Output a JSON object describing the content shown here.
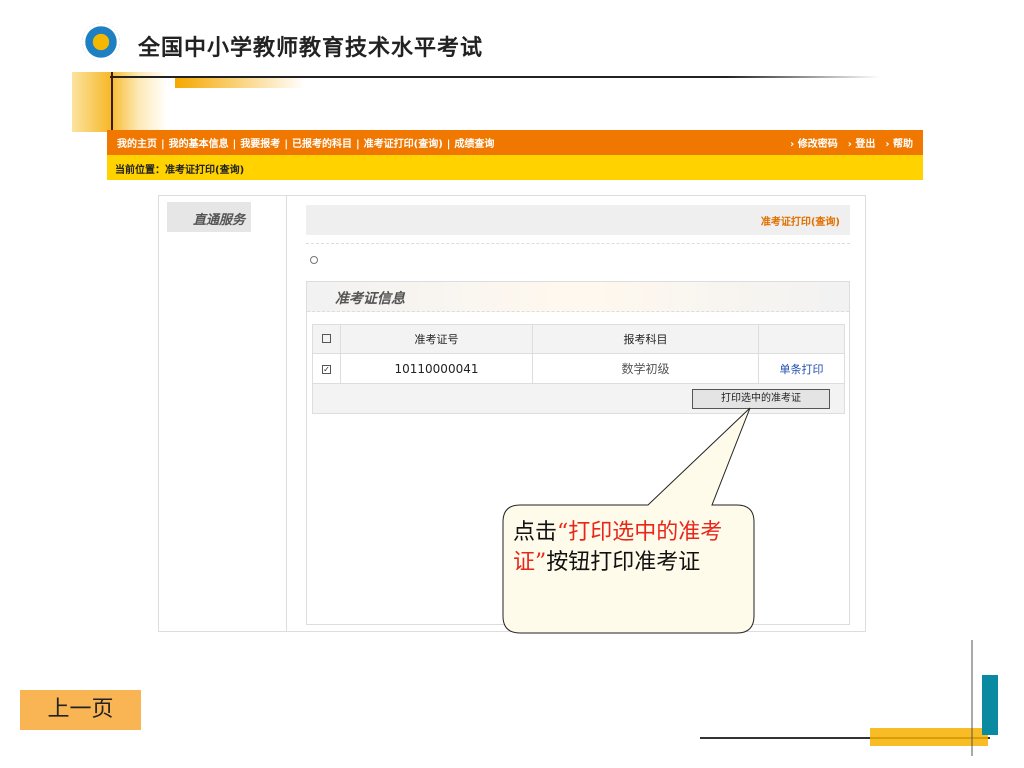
{
  "slide": {
    "title": "全国中小学教师教育技术水平考试",
    "prev_label": "上一页"
  },
  "nav": {
    "items": [
      "我的主页",
      "|",
      "我的基本信息",
      "|",
      "我要报考",
      "|",
      "已报考的科目",
      "|",
      "准考证打印(查询)",
      "|",
      "成绩查询"
    ],
    "right": [
      "› 修改密码",
      "› 登出",
      "› 帮助"
    ]
  },
  "breadcrumb": "当前位置：准考证打印(查询)",
  "sidebar": {
    "header": "直通服务"
  },
  "main": {
    "header": "准考证打印(查询)",
    "radio": "○",
    "section_title": "准考证信息",
    "table": {
      "columns": [
        "准考证号",
        "报考科目",
        ""
      ],
      "rows": [
        {
          "checked": "☑",
          "id": "10110000041",
          "subject": "数学初级",
          "action": "单条打印"
        }
      ]
    },
    "print_selected": "打印选中的准考证"
  },
  "callout": {
    "pre": "点击",
    "quote": "“打印选中的准考证”",
    "post": "按钮打印准考证"
  },
  "colors": {
    "nav": "#f07800",
    "crumb": "#ffd200",
    "accent": "#e07000"
  }
}
